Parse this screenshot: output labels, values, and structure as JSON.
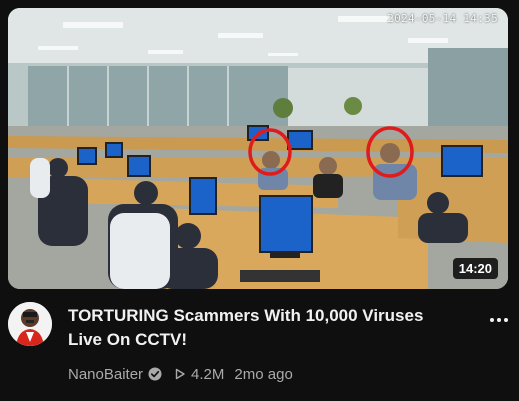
{
  "video": {
    "title_line1": "TORTURING Scammers With 10,000 Viruses",
    "title_line2": "Live On CCTV!",
    "duration": "14:20",
    "cctv_timestamp": "2024-05-14 14:35",
    "channel": "NanoBaiter",
    "views": "4.2M",
    "age": "2mo ago"
  },
  "icons": {
    "verified": "verified-check-icon",
    "views": "play-triangle-icon",
    "more": "more-vert-icon"
  },
  "colors": {
    "background": "#0f0f0f",
    "title": "#f1f1f1",
    "secondary": "#aaaaaa",
    "highlight_circle": "#e01b1b",
    "bsod_blue": "#1c63c9"
  }
}
